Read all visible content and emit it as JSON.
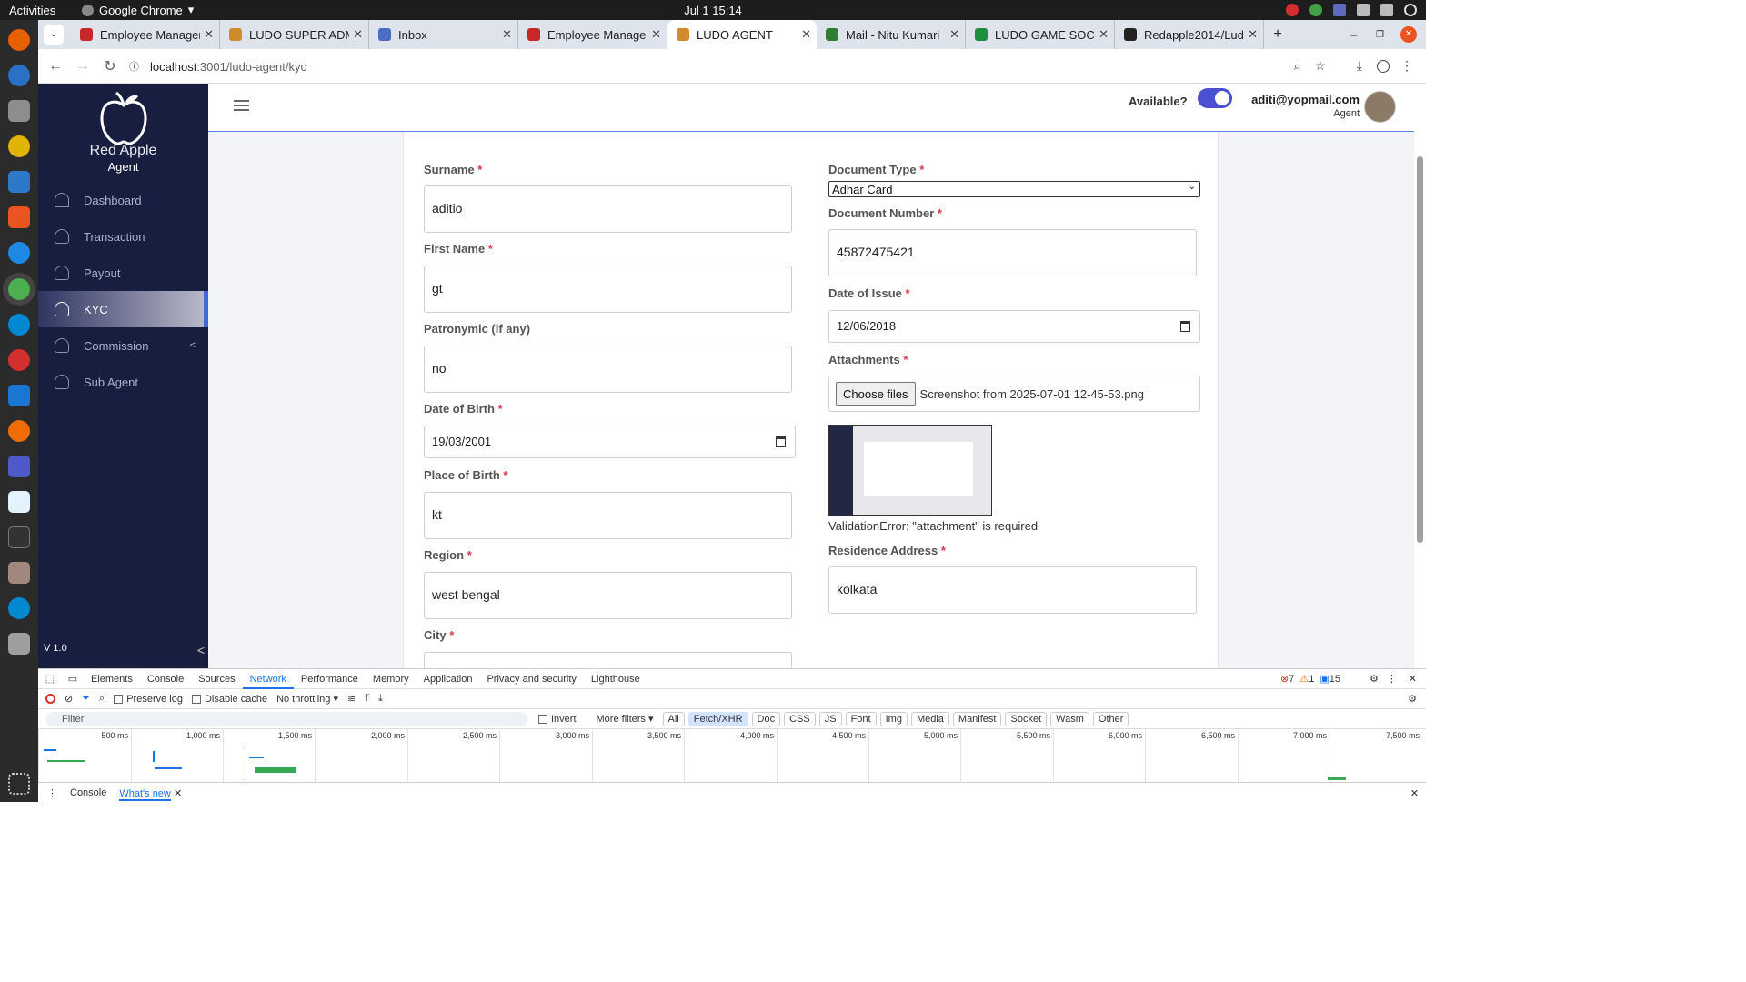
{
  "os": {
    "activities": "Activities",
    "app_name": "Google Chrome",
    "clock": "Jul 1  15:14"
  },
  "browser": {
    "tabs": [
      {
        "label": "Employee Manager",
        "color": "#c62828"
      },
      {
        "label": "LUDO SUPER ADMI",
        "color": "#d28b2c"
      },
      {
        "label": "Inbox",
        "color": "#4a6cc2"
      },
      {
        "label": "Employee Manager",
        "color": "#c62828"
      },
      {
        "label": "LUDO AGENT",
        "color": "#d28b2c"
      },
      {
        "label": "Mail - Nitu Kumari",
        "color": "#2e7d32"
      },
      {
        "label": "LUDO GAME SOCK",
        "color": "#1e8e3e"
      },
      {
        "label": "Redapple2014/Lud",
        "color": "#222222"
      }
    ],
    "url_host": "localhost",
    "url_path": ":3001/ludo-agent/kyc"
  },
  "sidebar": {
    "brand": "Red Apple",
    "sub": "Agent",
    "items": [
      {
        "label": "Dashboard"
      },
      {
        "label": "Transaction"
      },
      {
        "label": "Payout"
      },
      {
        "label": "KYC"
      },
      {
        "label": "Commission"
      },
      {
        "label": "Sub Agent"
      }
    ],
    "version": "V 1.0"
  },
  "header": {
    "available_label": "Available?",
    "toggle_on": true,
    "email": "aditi@yopmail.com",
    "role": "Agent"
  },
  "form": {
    "surname": {
      "label": "Surname",
      "value": "aditio"
    },
    "first_name": {
      "label": "First Name",
      "value": "gt"
    },
    "patronymic": {
      "label": "Patronymic (if any)",
      "value": "no"
    },
    "dob": {
      "label": "Date of Birth",
      "value": "19/03/2001"
    },
    "place_of_birth": {
      "label": "Place of Birth",
      "value": "kt"
    },
    "region": {
      "label": "Region",
      "value": "west bengal"
    },
    "city": {
      "label": "City"
    },
    "doc_type": {
      "label": "Document Type",
      "value": "Adhar Card"
    },
    "doc_number": {
      "label": "Document Number",
      "value": "45872475421"
    },
    "date_of_issue": {
      "label": "Date of Issue",
      "value": "12/06/2018"
    },
    "attachments": {
      "label": "Attachments",
      "button": "Choose files",
      "file_name": "Screenshot from 2025-07-01 12-45-53.png"
    },
    "validation_error": "ValidationError: \"attachment\" is required",
    "residence": {
      "label": "Residence Address",
      "value": "kolkata"
    },
    "required_mark": "*"
  },
  "devtools": {
    "tabs": [
      "Elements",
      "Console",
      "Sources",
      "Network",
      "Performance",
      "Memory",
      "Application",
      "Privacy and security",
      "Lighthouse"
    ],
    "active_tab": "Network",
    "errors": "7",
    "warnings": "1",
    "messages": "15",
    "preserve_log": "Preserve log",
    "disable_cache": "Disable cache",
    "throttling": "No throttling",
    "filter_placeholder": "Filter",
    "invert": "Invert",
    "more_filters": "More filters",
    "chips": [
      "All",
      "Fetch/XHR",
      "Doc",
      "CSS",
      "JS",
      "Font",
      "Img",
      "Media",
      "Manifest",
      "Socket",
      "Wasm",
      "Other"
    ],
    "ticks": [
      "500 ms",
      "1,000 ms",
      "1,500 ms",
      "2,000 ms",
      "2,500 ms",
      "3,000 ms",
      "3,500 ms",
      "4,000 ms",
      "4,500 ms",
      "5,000 ms",
      "5,500 ms",
      "6,000 ms",
      "6,500 ms",
      "7,000 ms",
      "7,500 ms"
    ],
    "drawer_tabs": [
      "Console",
      "What's new"
    ]
  }
}
